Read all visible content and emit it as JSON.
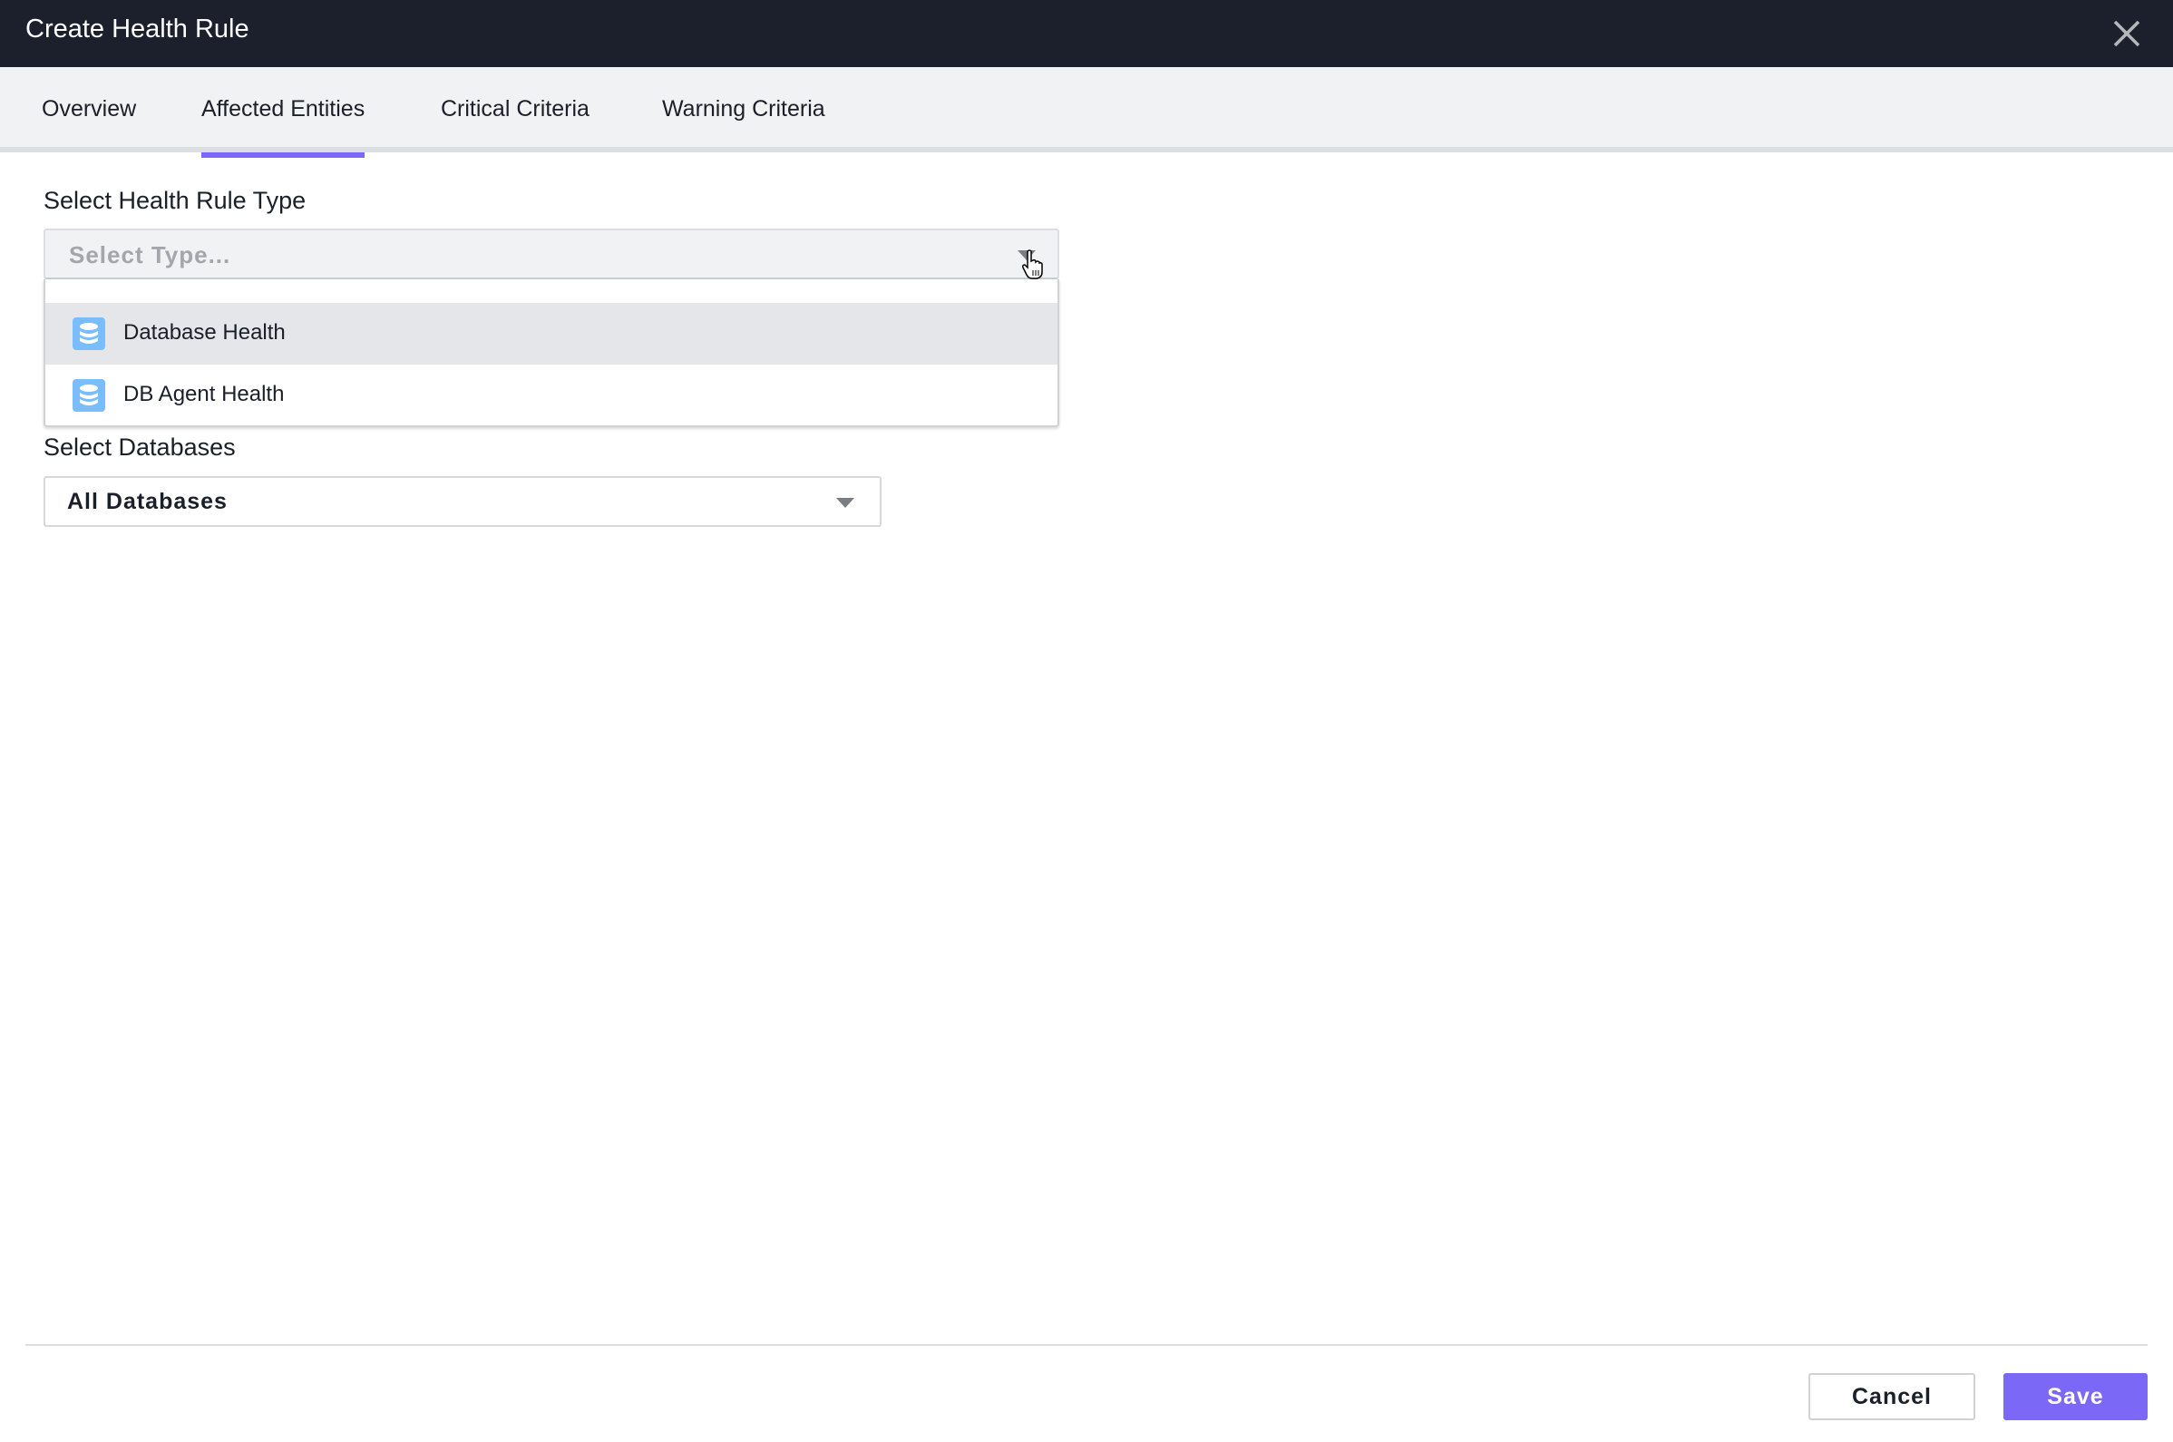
{
  "dialog": {
    "title": "Create Health Rule",
    "close_icon": "close-icon"
  },
  "tabs": [
    {
      "label": "Overview",
      "active": false
    },
    {
      "label": "Affected Entities",
      "active": true
    },
    {
      "label": "Critical Criteria",
      "active": false
    },
    {
      "label": "Warning Criteria",
      "active": false
    }
  ],
  "health_rule_type": {
    "label": "Select Health Rule Type",
    "placeholder": "Select Type...",
    "expanded": true,
    "options": [
      {
        "label": "Database Health",
        "icon": "database-icon",
        "highlighted": true
      },
      {
        "label": "DB Agent Health",
        "icon": "database-icon",
        "highlighted": false
      }
    ]
  },
  "databases": {
    "label": "Select Databases",
    "value": "All Databases"
  },
  "footer": {
    "cancel_label": "Cancel",
    "save_label": "Save"
  },
  "colors": {
    "header_bg": "#1b202c",
    "accent": "#7b68f6",
    "icon_blue": "#79bdfd"
  }
}
